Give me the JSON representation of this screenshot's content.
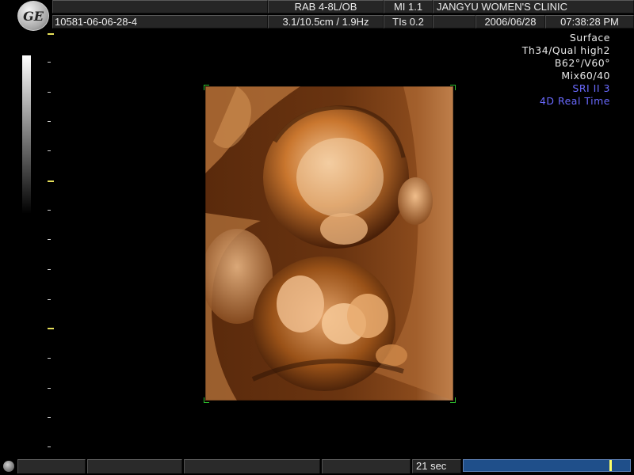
{
  "header": {
    "logo_text": "GE",
    "probe": "RAB 4-8L/OB",
    "mi": "MI  1.1",
    "clinic": "JANGYU WOMEN'S CLINIC",
    "patient_id": "10581-06-06-28-4",
    "depth_freq": "3.1/10.5cm / 1.9Hz",
    "tis": "TIs  0.2",
    "date": "2006/06/28",
    "time": "07:38:28 PM"
  },
  "settings": {
    "mode": "Surface",
    "threshold_quality": "Th34/Qual high2",
    "angles": "B62°/V60°",
    "mix": "Mix60/40",
    "sri": "SRI II 3",
    "realtime": "4D Real Time"
  },
  "colors": {
    "sri": "#6a6aff",
    "realtime": "#6a6aff",
    "frame_corner": "#2ec02e",
    "render_tint": "#b8642a",
    "progress": "#1f4f8a"
  },
  "footer": {
    "elapsed": "21 sec",
    "progress_fraction": 0.89
  }
}
